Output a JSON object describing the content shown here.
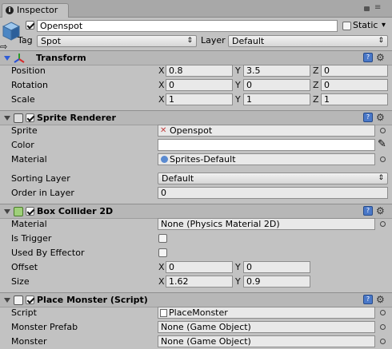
{
  "window": {
    "tab_title": "Inspector"
  },
  "gameobject": {
    "name": "Openspot",
    "static_label": "Static",
    "tag_label": "Tag",
    "tag_value": "Spot",
    "layer_label": "Layer",
    "layer_value": "Default"
  },
  "transform": {
    "title": "Transform",
    "position": {
      "label": "Position",
      "x": "0.8",
      "y": "3.5",
      "z": "0"
    },
    "rotation": {
      "label": "Rotation",
      "x": "0",
      "y": "0",
      "z": "0"
    },
    "scale": {
      "label": "Scale",
      "x": "1",
      "y": "1",
      "z": "1"
    }
  },
  "sprite_renderer": {
    "title": "Sprite Renderer",
    "sprite_label": "Sprite",
    "sprite_value": "Openspot",
    "color_label": "Color",
    "material_label": "Material",
    "material_value": "Sprites-Default",
    "sorting_layer_label": "Sorting Layer",
    "sorting_layer_value": "Default",
    "order_label": "Order in Layer",
    "order_value": "0"
  },
  "box_collider": {
    "title": "Box Collider 2D",
    "material_label": "Material",
    "material_value": "None (Physics Material 2D)",
    "is_trigger_label": "Is Trigger",
    "used_by_effector_label": "Used By Effector",
    "offset": {
      "label": "Offset",
      "x": "0",
      "y": "0"
    },
    "size": {
      "label": "Size",
      "x": "1.62",
      "y": "0.9"
    }
  },
  "place_monster": {
    "title": "Place Monster (Script)",
    "script_label": "Script",
    "script_value": "PlaceMonster",
    "monster_prefab_label": "Monster Prefab",
    "monster_prefab_value": "None (Game Object)",
    "monster_label": "Monster",
    "monster_value": "None (Game Object)"
  },
  "axes": {
    "x": "X",
    "y": "Y",
    "z": "Z"
  }
}
